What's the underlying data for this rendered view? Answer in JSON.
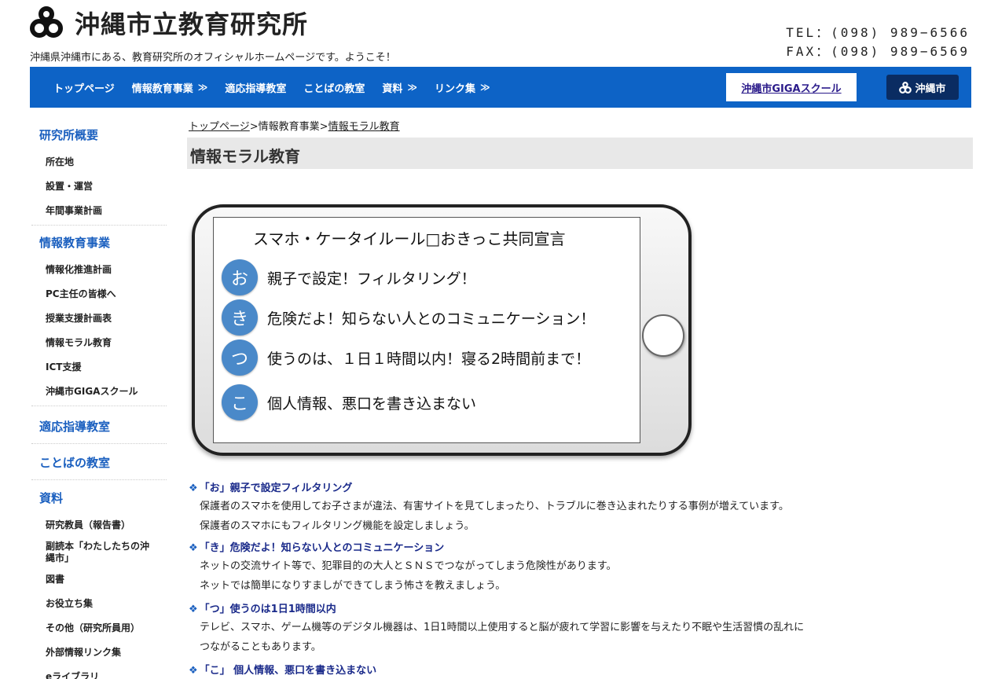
{
  "header": {
    "site_title": "沖縄市立教育研究所",
    "tagline": "沖縄県沖縄市にある、教育研究所のオフィシャルホームページです。ようこそ！",
    "tel": "TEL：(098) 989−6566",
    "fax": "FAX：(098) 989−6569"
  },
  "nav": {
    "items": [
      {
        "label": "トップページ",
        "chevron": ""
      },
      {
        "label": "情報教育事業",
        "chevron": "≫"
      },
      {
        "label": "適応指導教室",
        "chevron": ""
      },
      {
        "label": "ことばの教室",
        "chevron": ""
      },
      {
        "label": "資料",
        "chevron": "≫"
      },
      {
        "label": "リンク集",
        "chevron": "≫"
      }
    ],
    "giga_label": "沖縄市GIGAスクール",
    "city_label": "沖縄市"
  },
  "sidebar": {
    "sections": [
      {
        "heading": "研究所概要",
        "items": [
          "所在地",
          "設置・運営",
          "年間事業計画"
        ]
      },
      {
        "heading": "情報教育事業",
        "items": [
          "情報化推進計画",
          "PC主任の皆様へ",
          "授業支援計画表",
          "情報モラル教育",
          "ICT支援",
          "沖縄市GIGAスクール"
        ]
      },
      {
        "heading": "適応指導教室",
        "items": []
      },
      {
        "heading": "ことばの教室",
        "items": []
      },
      {
        "heading": "資料",
        "items": [
          "研究教員（報告書）",
          "副読本「わたしたちの沖縄市」",
          "図書",
          "お役立ち集",
          "その他（研究所員用）",
          "外部情報リンク集",
          "eライブラリ"
        ]
      }
    ]
  },
  "breadcrumb": {
    "home": "トップページ",
    "sep1": ">",
    "parent": "情報教育事業",
    "sep2": ">",
    "current": "情報モラル教育"
  },
  "page_title": "情報モラル教育",
  "phone": {
    "title": "スマホ・ケータイルール□おきっこ共同宣言",
    "rules": [
      {
        "char": "お",
        "text": "親子で設定！フィルタリング！"
      },
      {
        "char": "き",
        "text": "危険だよ！知らない人とのコミュニケーション！"
      },
      {
        "char": "つ",
        "text": "使うのは、１日１時間以内！寝る2時間前まで！"
      },
      {
        "char": "こ",
        "text": "個人情報、悪口を書き込まない"
      }
    ]
  },
  "rules_detail": [
    {
      "heading": "「お」親子で設定フィルタリング",
      "lines": [
        "保護者のスマホを使用してお子さまが違法、有害サイトを見てしまったり、トラブルに巻き込まれたりする事例が増えています。",
        "保護者のスマホにもフィルタリング機能を設定しましょう。"
      ]
    },
    {
      "heading": "「き」危険だよ！知らない人とのコミュニケーション",
      "lines": [
        "ネットの交流サイト等で、犯罪目的の大人とＳＮＳでつながってしまう危険性があります。",
        "ネットでは簡単になりすましができてしまう怖さを教えましょう。"
      ]
    },
    {
      "heading": "「つ」使うのは1日1時間以内",
      "lines": [
        "テレビ、スマホ、ゲーム機等のデジタル機器は、1日1時間以上使用すると脳が疲れて学習に影響を与えたり不眠や生活習慣の乱れに",
        "つながることもあります。"
      ]
    },
    {
      "heading": "「こ」 個人情報、悪口を書き込まない",
      "lines": []
    }
  ],
  "icons": {
    "logo": "okinawa-city-emblem-icon",
    "diamond": "diamond-bullet-icon"
  },
  "colors": {
    "nav_bg": "#0d63c6",
    "sidebar_heading": "#1a5fbf",
    "rule_circle": "#4a89c9",
    "city_btn": "#0a2c62"
  }
}
